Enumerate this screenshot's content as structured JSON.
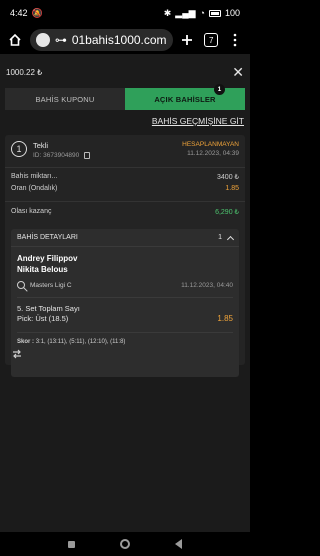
{
  "status_bar": {
    "time": "4:42",
    "battery": "100"
  },
  "browser": {
    "url": "01bahis1000.com",
    "tab_count": "7"
  },
  "app": {
    "balance": "1000.22 ₺",
    "tabs": {
      "coupon": "BAHİS KUPONU",
      "open_bets": "AÇIK BAHİSLER",
      "open_bets_count": "1"
    },
    "history_link": "BAHİS GEÇMİŞİNE GİT"
  },
  "bet": {
    "number": "1",
    "type": "Tekli",
    "id_label": "ID:",
    "id": "3673904890",
    "status": "HESAPLANMAYAN",
    "datetime": "11.12.2023, 04:39",
    "stake_label": "Bahis miktarı...",
    "stake": "3400 ₺",
    "odds_label": "Oran (Ondalık)",
    "odds": "1.85",
    "potential_label": "Olası kazanç",
    "potential": "6,290 ₺"
  },
  "details": {
    "title": "BAHİS DETAYLARI",
    "count": "1",
    "player1": "Andrey Filippov",
    "player2": "Nikita Belous",
    "league": "Masters Ligi C",
    "match_datetime": "11.12.2023, 04:40",
    "market": "5. Set Toplam Sayı",
    "pick": "Pick: Üst (18.5)",
    "odds": "1.85",
    "score_label": "Skor :",
    "score": "3:1, (13:11), (5:11), (12:10), (11:8)"
  }
}
